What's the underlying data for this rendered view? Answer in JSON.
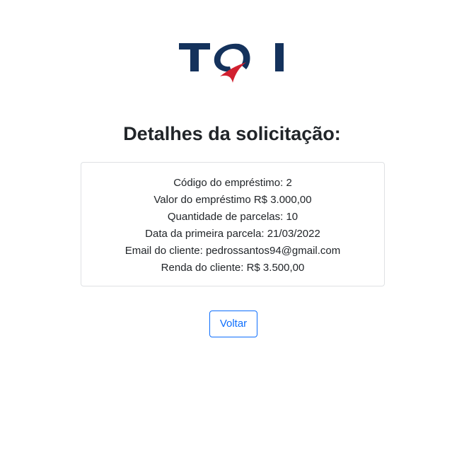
{
  "logo": {
    "text": "TQI",
    "colors": {
      "navy": "#14325c",
      "red": "#d1202f"
    }
  },
  "heading": "Detalhes da solicitação:",
  "details": {
    "loan_code": "Código do empréstimo: 2",
    "loan_value": "Valor do empréstimo R$ 3.000,00",
    "installments": "Quantidade de parcelas: 10",
    "first_installment_date": "Data da primeira parcela: 21/03/2022",
    "client_email": "Email do cliente: pedrossantos94@gmail.com",
    "client_income": "Renda do cliente: R$ 3.500,00"
  },
  "actions": {
    "back_label": "Voltar"
  },
  "colors": {
    "primary": "#0d6efd",
    "text": "#212529",
    "border": "#dfe1e4"
  }
}
